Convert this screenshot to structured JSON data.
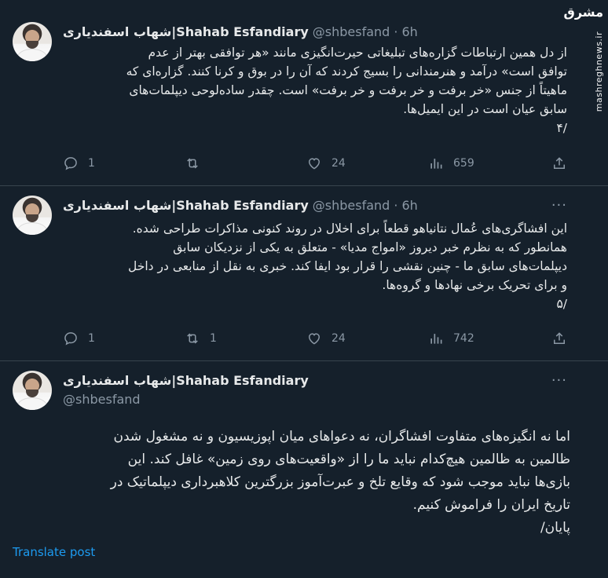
{
  "watermark": {
    "logo": "مشرق",
    "site": "mashreghnews.ir"
  },
  "tweets": [
    {
      "name": "شهاب اسفندیاری|Shahab Esfandiary",
      "handle": "@shbesfand",
      "time": "· 6h",
      "more": "···",
      "lines": [
        "از دل همین ارتباطات گزاره‌های تبلیغاتی حیرت‌انگیزی مانند «هر توافقی بهتر از عدم",
        "توافق است» درآمد و هنرمندانی را بسیج کردند که آن را در بوق و کرنا کنند. گزاره‌ای که",
        "ماهیتاً از جنس «خر برفت و خر برفت و خر برفت» است. چقدر ساده‌لوحی دیپلمات‌های",
        "سابق عیان است در این ایمیل‌ها.",
        "/۴"
      ],
      "stats": {
        "replies": "1",
        "reposts": "",
        "likes": "24",
        "views": "659"
      }
    },
    {
      "name": "شهاب اسفندیاری|Shahab Esfandiary",
      "handle": "@shbesfand",
      "time": "· 6h",
      "more": "···",
      "lines": [
        "این افشاگری‌های عُمال نتانیاهو قطعاً برای اخلال در روند کنونی مذاکرات طراحی شده.",
        "همانطور که به نظرم خبر دیروز «امواج مدیا» - متعلق به یکی از نزدیکان سابق",
        "دیپلمات‌های سابق ما - چنین نقشی را قرار بود ایفا کند. خبری به نقل از منابعی در داخل",
        "و برای تحریک برخی نهادها و گروه‌ها.",
        "/۵"
      ],
      "stats": {
        "replies": "1",
        "reposts": "1",
        "likes": "24",
        "views": "742"
      }
    },
    {
      "name": "شهاب اسفندیاری|Shahab Esfandiary",
      "handle": "@shbesfand",
      "more": "···",
      "lines": [
        "اما نه انگیزه‌های متفاوت افشاگران، نه دعواهای میان اپوزیسیون و نه مشغول شدن",
        "ظالمین به ظالمین هیچ‌کدام نباید ما را از «واقعیت‌های روی زمین» غافل کند. این",
        "بازی‌ها نباید موجب شود که وقایع تلخ و عبرت‌آموز بزرگترین کلاهبرداری دیپلماتیک در",
        "تاریخ ایران را فراموش کنیم.",
        "پایان/"
      ],
      "translate": "Translate post"
    }
  ]
}
